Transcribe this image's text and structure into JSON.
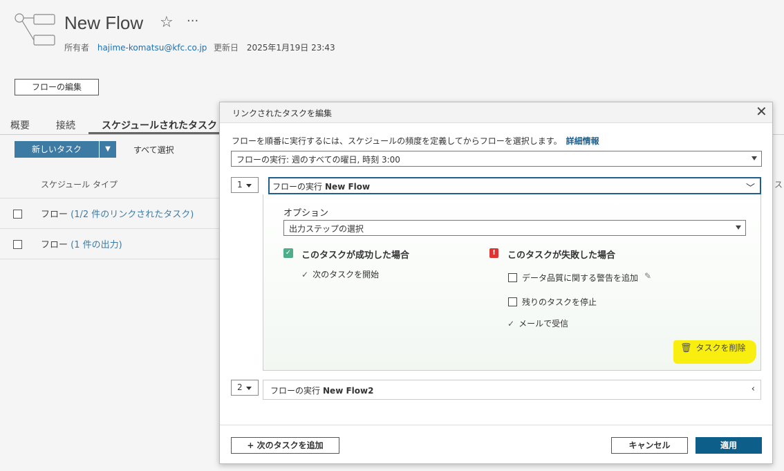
{
  "header": {
    "title": "New Flow",
    "owner_label": "所有者",
    "owner_value": "hajime-komatsu@kfc.co.jp",
    "updated_label": "更新日",
    "updated_value": "2025年1月19日 23:43",
    "edit_flow_label": "フローの編集"
  },
  "tabs": [
    {
      "label": "概要"
    },
    {
      "label": "接続"
    },
    {
      "label": "スケジュールされたタスク"
    }
  ],
  "toolbar": {
    "new_task_label": "新しいタスク",
    "select_all_label": "すべて選択"
  },
  "table": {
    "column_header": "スケジュール タイプ",
    "right_cut_text": "ス",
    "rows": [
      {
        "prefix": "フロー",
        "link": "(1/2 件のリンクされたタスク)"
      },
      {
        "prefix": "フロー",
        "link": "(1 件の出力)"
      }
    ]
  },
  "dialog": {
    "title": "リンクされたタスクを編集",
    "description": "フローを順番に実行するには、スケジュールの頻度を定義してからフローを選択します。",
    "detail_link": "詳細情報",
    "frequency_value": "フローの実行: 週のすべての曜日, 時刻 3:00",
    "tasks": [
      {
        "number": "1",
        "prefix": "フローの実行",
        "flow_name": "New Flow",
        "option_label": "オプション",
        "option_value": "出力ステップの選択",
        "success_title": "このタスクが成功した場合",
        "success_items": [
          "次のタスクを開始"
        ],
        "failure_title": "このタスクが失敗した場合",
        "failure_items": {
          "data_quality": "データ品質に関する警告を追加",
          "stop_remaining": "残りのタスクを停止",
          "email": "メールで受信"
        },
        "delete_label": "タスクを削除"
      },
      {
        "number": "2",
        "prefix": "フローの実行",
        "flow_name": "New Flow2"
      }
    ],
    "add_next_label": "+ 次のタスクを追加",
    "cancel_label": "キャンセル",
    "apply_label": "適用"
  },
  "colors": {
    "accent": "#3d7ba4",
    "apply_button": "#0d5f8a",
    "success_badge": "#4cae8a",
    "failure_badge": "#dd3333",
    "highlight": "#f8ee10"
  },
  "icons": {
    "flow": "flow-icon",
    "star": "star-icon",
    "more": "more-icon",
    "close": "close-icon",
    "trash": "trash-icon",
    "pencil": "pencil-icon"
  }
}
